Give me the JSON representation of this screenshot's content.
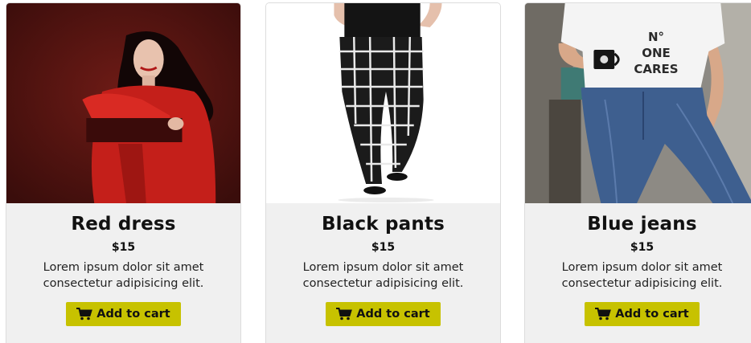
{
  "products": [
    {
      "name": "Red dress",
      "price": "$15",
      "description": "Lorem ipsum dolor sit amet consectetur adipisicing elit.",
      "button_label": "Add to cart",
      "button_icon": "shopping-cart-icon"
    },
    {
      "name": "Black pants",
      "price": "$15",
      "description": "Lorem ipsum dolor sit amet consectetur adipisicing elit.",
      "button_label": "Add to cart",
      "button_icon": "shopping-cart-icon"
    },
    {
      "name": "Blue jeans",
      "price": "$15",
      "description": "Lorem ipsum dolor sit amet consectetur adipisicing elit.",
      "button_label": "Add to cart",
      "button_icon": "shopping-cart-icon"
    }
  ],
  "tshirt_print": [
    "N°",
    "ONE",
    "CARES"
  ],
  "colors": {
    "button_background": "#c7c200",
    "card_background": "#f0f0f0"
  }
}
